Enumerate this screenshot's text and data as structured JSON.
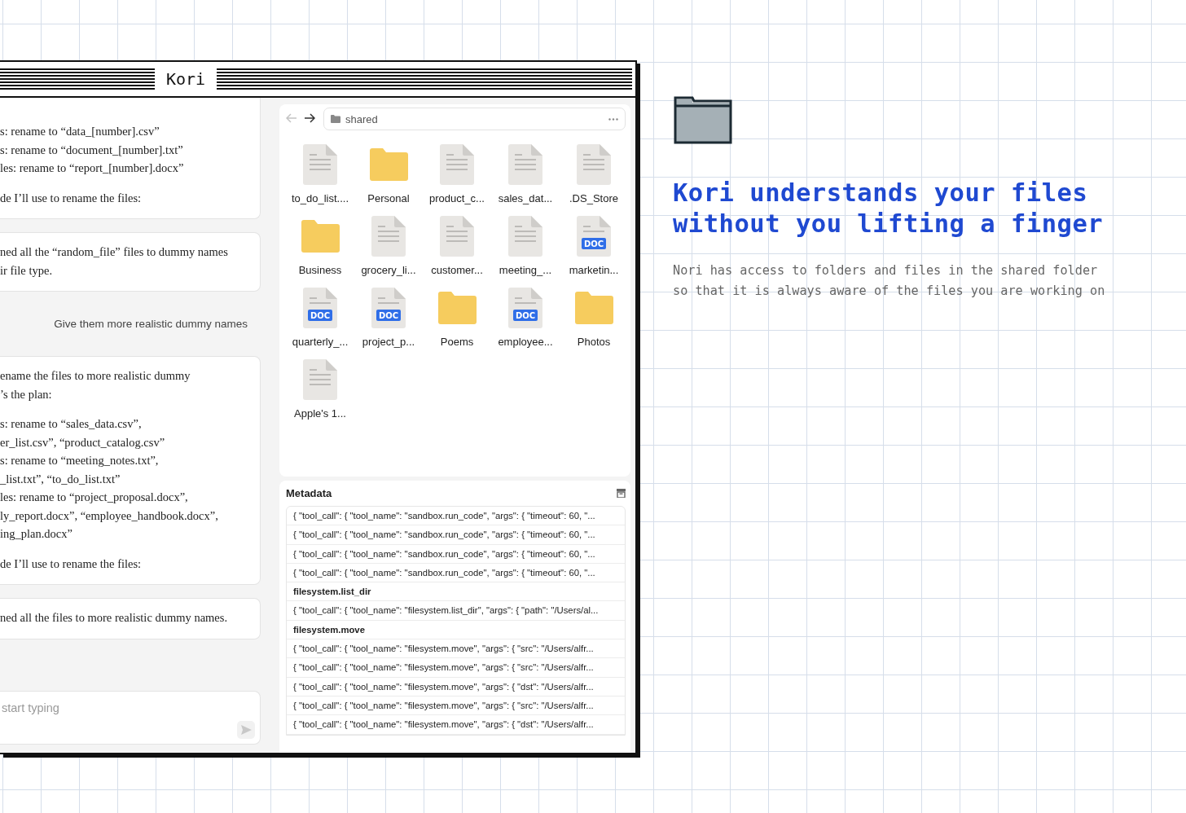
{
  "window": {
    "title": "Kori"
  },
  "chat": {
    "messages": [
      {
        "kind": "assistant",
        "paragraphs": [
          [
            "s: rename to “data_[number].csv”",
            "s: rename to “document_[number].txt”",
            "les: rename to “report_[number].docx”"
          ],
          [
            "de I’ll use to rename the files:"
          ]
        ]
      },
      {
        "kind": "assistant",
        "paragraphs": [
          [
            "ned all the “random_file” files to dummy names",
            "ir file type."
          ]
        ]
      },
      {
        "kind": "user",
        "paragraphs": [
          [
            "Give them more realistic dummy names"
          ]
        ]
      },
      {
        "kind": "assistant",
        "paragraphs": [
          [
            "ename the files to more realistic dummy",
            "’s the plan:"
          ],
          [
            "s: rename to “sales_data.csv”,",
            "er_list.csv”, “product_catalog.csv”",
            "s: rename to “meeting_notes.txt”,",
            "_list.txt”, “to_do_list.txt”",
            "les: rename to “project_proposal.docx”,",
            "ly_report.docx”, “employee_handbook.docx”,",
            "ing_plan.docx”"
          ],
          [
            "de I’ll use to rename the files:"
          ]
        ]
      },
      {
        "kind": "assistant",
        "paragraphs": [
          [
            "ned all the files to more realistic dummy names."
          ]
        ]
      }
    ],
    "input": {
      "placeholder": "start typing"
    }
  },
  "files": {
    "back": {
      "disabled": true
    },
    "forward": {
      "disabled": false
    },
    "path": "shared",
    "items": [
      {
        "name": "to_do_list....",
        "kind": "text"
      },
      {
        "name": "Personal",
        "kind": "folder"
      },
      {
        "name": "product_c...",
        "kind": "text"
      },
      {
        "name": "sales_dat...",
        "kind": "text"
      },
      {
        "name": ".DS_Store",
        "kind": "text"
      },
      {
        "name": "Business",
        "kind": "folder"
      },
      {
        "name": "grocery_li...",
        "kind": "text"
      },
      {
        "name": "customer...",
        "kind": "text"
      },
      {
        "name": "meeting_...",
        "kind": "text"
      },
      {
        "name": "marketin...",
        "kind": "doc",
        "badge": "DOC"
      },
      {
        "name": "quarterly_...",
        "kind": "doc",
        "badge": "DOC"
      },
      {
        "name": "project_p...",
        "kind": "doc",
        "badge": "DOC"
      },
      {
        "name": "Poems",
        "kind": "folder"
      },
      {
        "name": "employee...",
        "kind": "doc",
        "badge": "DOC"
      },
      {
        "name": "Photos",
        "kind": "folder"
      },
      {
        "name": "Apple's 1...",
        "kind": "text"
      }
    ]
  },
  "metadata": {
    "title": "Metadata",
    "rows": [
      {
        "kind": "call",
        "text": "{ \"tool_call\": { \"tool_name\": \"sandbox.run_code\", \"args\": { \"timeout\": 60, \"..."
      },
      {
        "kind": "call",
        "text": "{ \"tool_call\": { \"tool_name\": \"sandbox.run_code\", \"args\": { \"timeout\": 60, \"..."
      },
      {
        "kind": "call",
        "text": "{ \"tool_call\": { \"tool_name\": \"sandbox.run_code\", \"args\": { \"timeout\": 60, \"..."
      },
      {
        "kind": "call",
        "text": "{ \"tool_call\": { \"tool_name\": \"sandbox.run_code\", \"args\": { \"timeout\": 60, \"..."
      },
      {
        "kind": "heading",
        "text": "filesystem.list_dir"
      },
      {
        "kind": "call",
        "text": "{ \"tool_call\": { \"tool_name\": \"filesystem.list_dir\", \"args\": { \"path\": \"/Users/al..."
      },
      {
        "kind": "heading",
        "text": "filesystem.move"
      },
      {
        "kind": "call",
        "text": "{ \"tool_call\": { \"tool_name\": \"filesystem.move\", \"args\": { \"src\": \"/Users/alfr..."
      },
      {
        "kind": "call",
        "text": "{ \"tool_call\": { \"tool_name\": \"filesystem.move\", \"args\": { \"src\": \"/Users/alfr..."
      },
      {
        "kind": "call",
        "text": "{ \"tool_call\": { \"tool_name\": \"filesystem.move\", \"args\": { \"dst\": \"/Users/alfr..."
      },
      {
        "kind": "call",
        "text": "{ \"tool_call\": { \"tool_name\": \"filesystem.move\", \"args\": { \"src\": \"/Users/alfr..."
      },
      {
        "kind": "call",
        "text": "{ \"tool_call\": { \"tool_name\": \"filesystem.move\", \"args\": { \"dst\": \"/Users/alfr..."
      }
    ]
  },
  "hero": {
    "headline": [
      "Kori understands your files",
      "without you lifting a finger"
    ],
    "body": [
      "Nori has access to folders and files in the shared folder",
      "so that it is always aware of the files you are working on"
    ]
  }
}
